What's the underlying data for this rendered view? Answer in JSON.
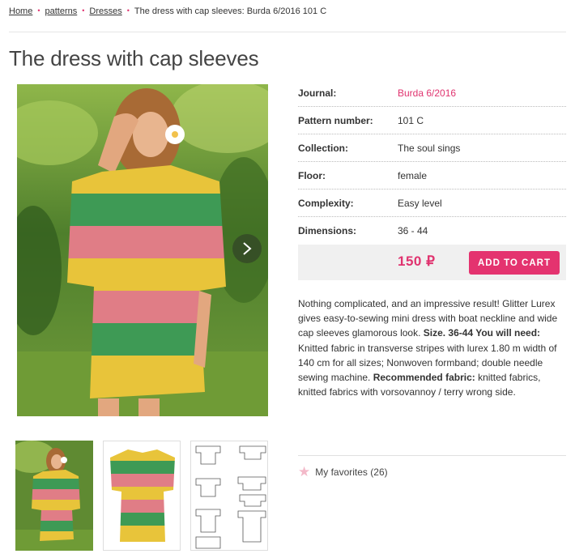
{
  "breadcrumb": {
    "home": "Home",
    "patterns": "patterns",
    "dresses": "Dresses",
    "current": "The dress with cap sleeves: Burda 6/2016 101 C",
    "separator": "•"
  },
  "title": "The dress with cap sleeves",
  "specs": {
    "journal_label": "Journal:",
    "journal_value": "Burda 6/2016",
    "pattern_label": "Pattern number:",
    "pattern_value": "101 C",
    "collection_label": "Collection:",
    "collection_value": "The soul sings",
    "floor_label": "Floor:",
    "floor_value": "female",
    "complexity_label": "Complexity:",
    "complexity_value": "Easy level",
    "dimensions_label": "Dimensions:",
    "dimensions_value": "36 - 44"
  },
  "price": "150 ₽",
  "cart_button": "ADD TO CART",
  "description": {
    "p1": "Nothing complicated, and an impressive result! Glitter Lurex gives easy-to-sewing mini dress with boat neckline and wide cap sleeves glamorous look. ",
    "size_label": "Size. 36-44 You will need:",
    "p2": " Knitted fabric in transverse stripes with lurex 1.80 m width of 140 cm for all sizes; Nonwoven formband; double needle sewing machine. ",
    "fabric_label": "Recommended fabric:",
    "p3": " knitted fabrics, knitted fabrics with vorsovannoy / terry wrong side."
  },
  "favorites": {
    "label": "My favorites",
    "count": "(26)"
  },
  "icons": {
    "next": "chevron-right-icon",
    "star": "star-icon"
  },
  "colors": {
    "accent": "#e4336f",
    "stripe_yellow": "#e8c43a",
    "stripe_green": "#3e9a55",
    "stripe_pink": "#e07d86"
  }
}
